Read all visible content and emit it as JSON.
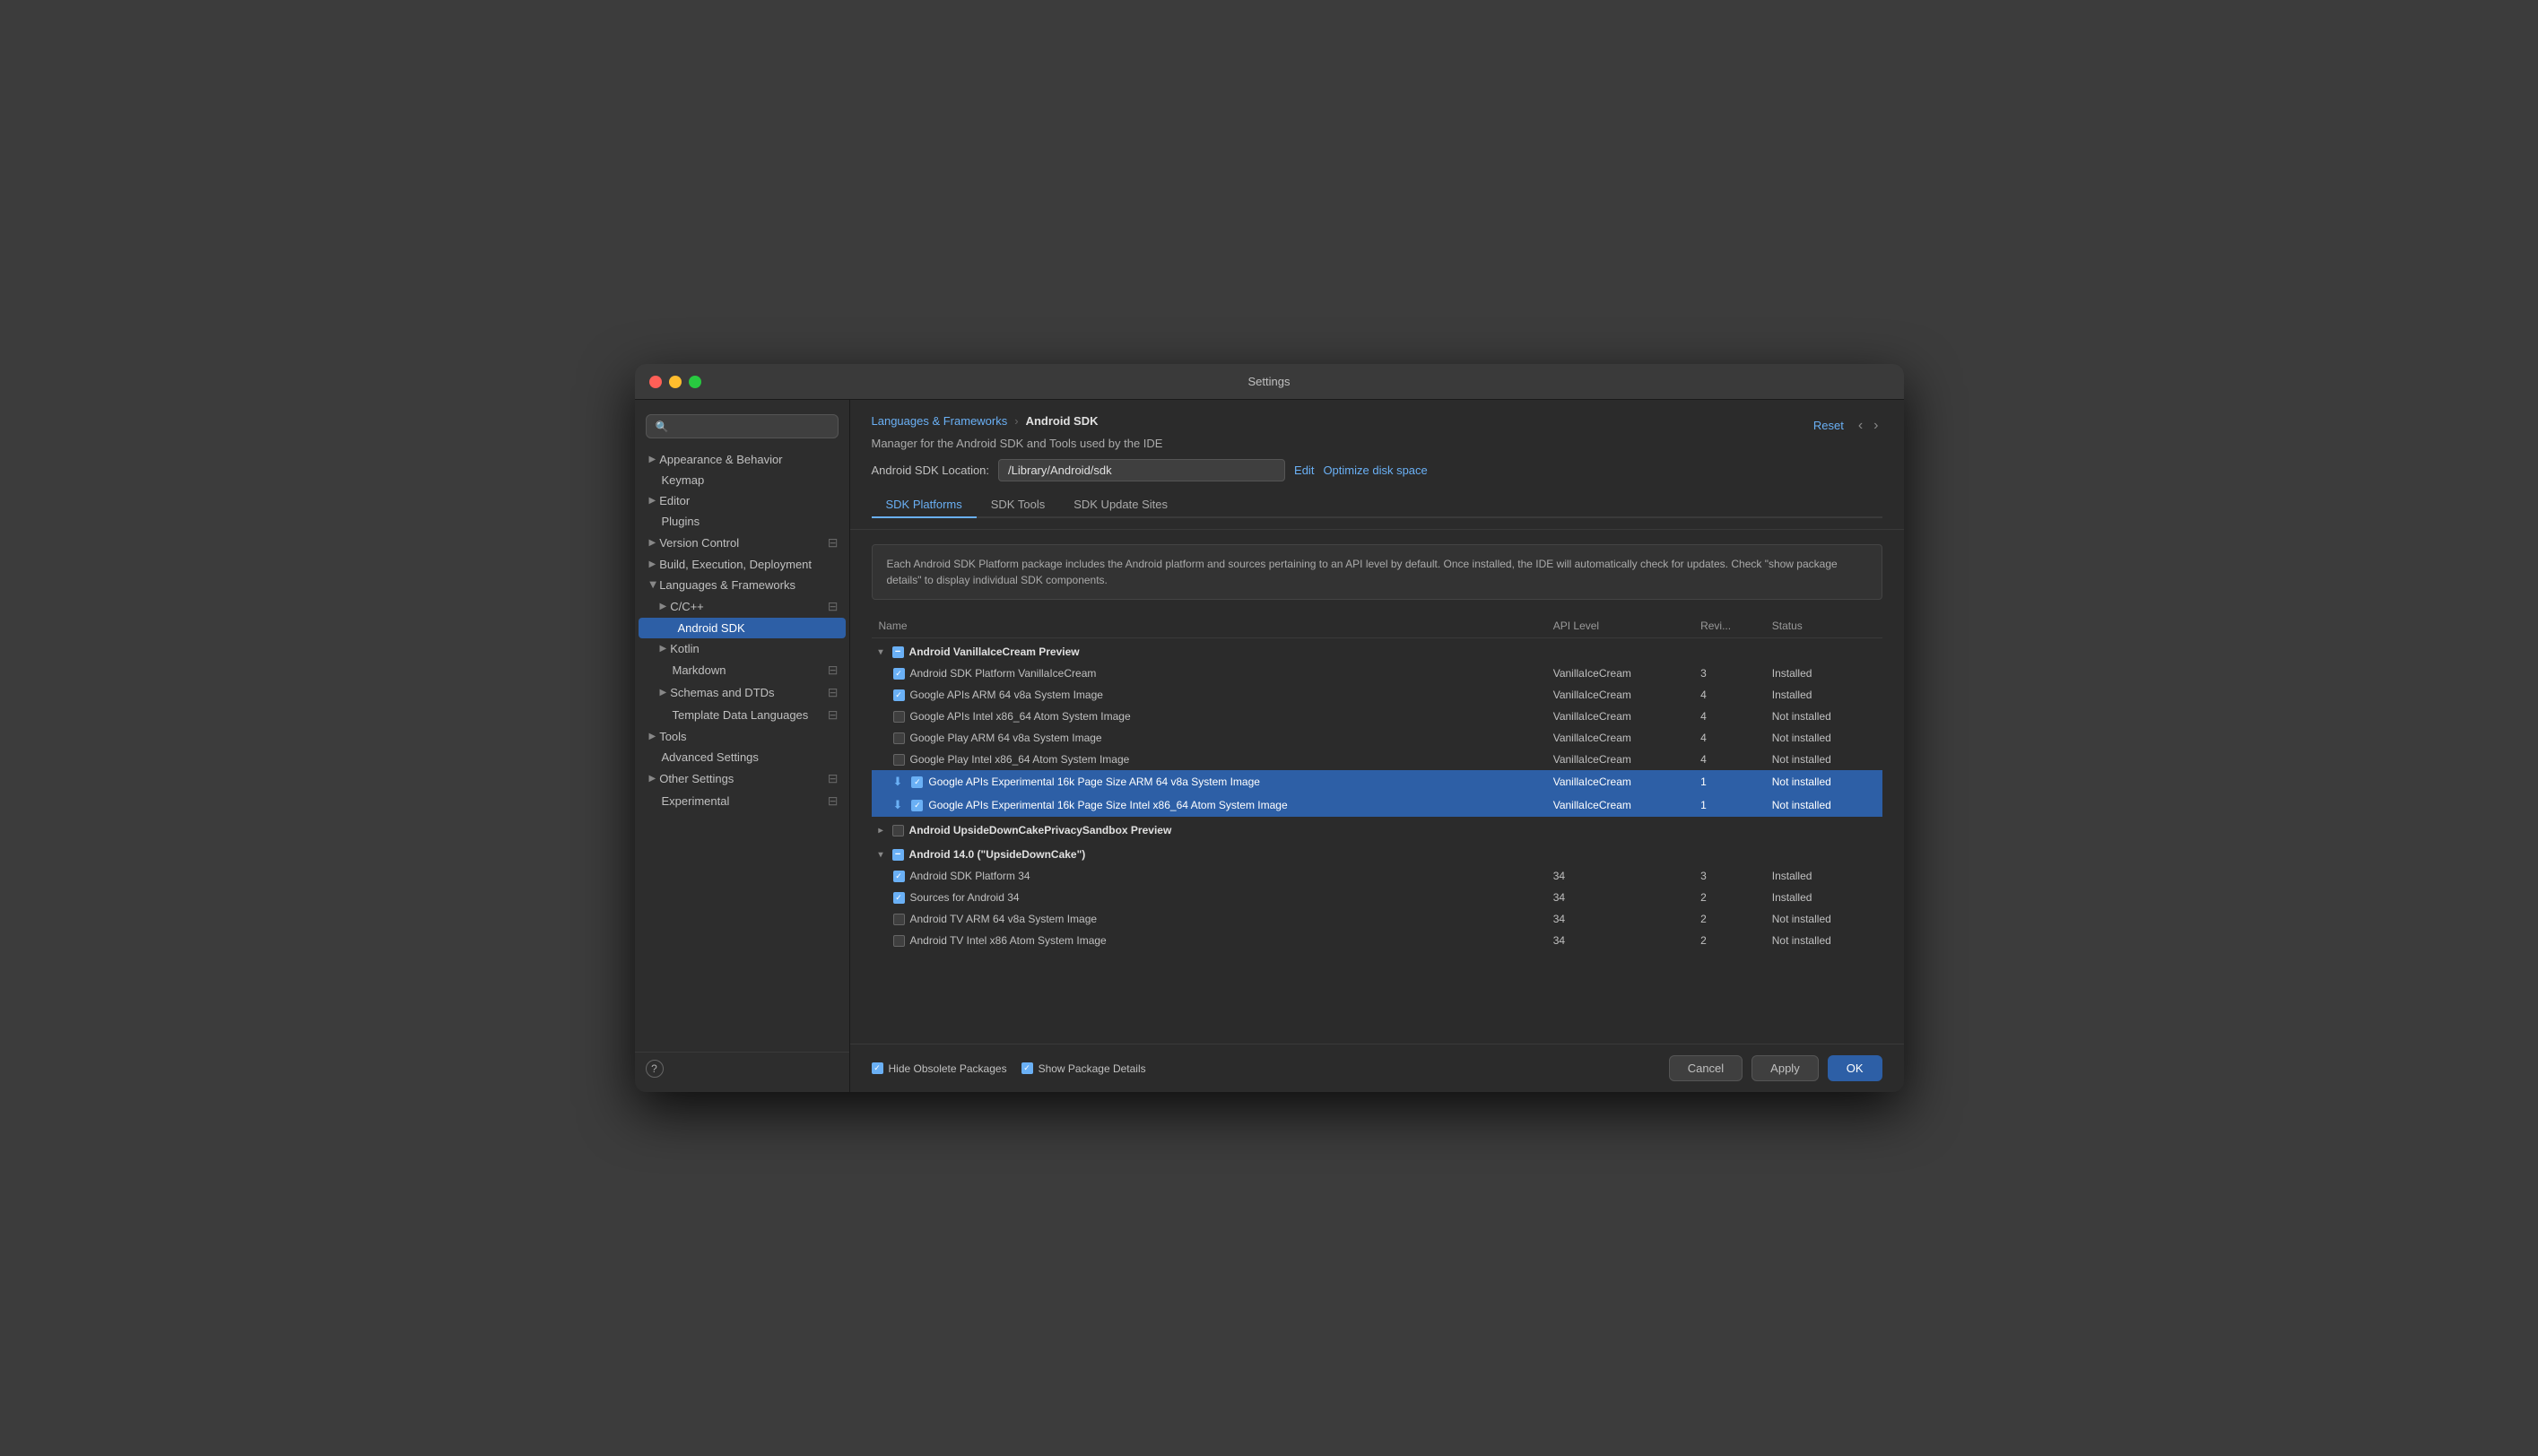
{
  "window": {
    "title": "Settings"
  },
  "sidebar": {
    "search_placeholder": "🔍",
    "items": [
      {
        "id": "appearance",
        "label": "Appearance & Behavior",
        "level": 0,
        "expandable": true,
        "expanded": false
      },
      {
        "id": "keymap",
        "label": "Keymap",
        "level": 0,
        "expandable": false
      },
      {
        "id": "editor",
        "label": "Editor",
        "level": 0,
        "expandable": true,
        "expanded": false
      },
      {
        "id": "plugins",
        "label": "Plugins",
        "level": 0,
        "expandable": false
      },
      {
        "id": "version-control",
        "label": "Version Control",
        "level": 0,
        "expandable": true,
        "expanded": false
      },
      {
        "id": "build",
        "label": "Build, Execution, Deployment",
        "level": 0,
        "expandable": true,
        "expanded": false
      },
      {
        "id": "languages",
        "label": "Languages & Frameworks",
        "level": 0,
        "expandable": true,
        "expanded": true
      },
      {
        "id": "cpp",
        "label": "C/C++",
        "level": 1,
        "expandable": true,
        "expanded": false
      },
      {
        "id": "android-sdk",
        "label": "Android SDK",
        "level": 2,
        "expandable": false,
        "selected": true
      },
      {
        "id": "kotlin",
        "label": "Kotlin",
        "level": 1,
        "expandable": true,
        "expanded": false
      },
      {
        "id": "markdown",
        "label": "Markdown",
        "level": 1,
        "expandable": false,
        "has_icon": true
      },
      {
        "id": "schemas",
        "label": "Schemas and DTDs",
        "level": 1,
        "expandable": true,
        "expanded": false
      },
      {
        "id": "template",
        "label": "Template Data Languages",
        "level": 1,
        "expandable": false,
        "has_icon": true
      },
      {
        "id": "tools",
        "label": "Tools",
        "level": 0,
        "expandable": true,
        "expanded": false
      },
      {
        "id": "advanced",
        "label": "Advanced Settings",
        "level": 0,
        "expandable": false
      },
      {
        "id": "other",
        "label": "Other Settings",
        "level": 0,
        "expandable": true,
        "expanded": false
      },
      {
        "id": "experimental",
        "label": "Experimental",
        "level": 0,
        "expandable": false,
        "has_icon": true
      }
    ]
  },
  "content": {
    "breadcrumb": {
      "parent": "Languages & Frameworks",
      "separator": "›",
      "current": "Android SDK"
    },
    "description": "Manager for the Android SDK and Tools used by the IDE",
    "sdk_location_label": "Android SDK Location:",
    "sdk_location_value": "/Library/Android/sdk",
    "edit_label": "Edit",
    "optimize_label": "Optimize disk space",
    "reset_label": "Reset",
    "tabs": [
      {
        "id": "platforms",
        "label": "SDK Platforms",
        "active": true
      },
      {
        "id": "tools",
        "label": "SDK Tools",
        "active": false
      },
      {
        "id": "update-sites",
        "label": "SDK Update Sites",
        "active": false
      }
    ],
    "info_text": "Each Android SDK Platform package includes the Android platform and sources pertaining to an API level by default. Once installed, the IDE will automatically check for updates. Check \"show package details\" to display individual SDK components.",
    "table": {
      "columns": [
        "Name",
        "API Level",
        "Revi...",
        "Status"
      ],
      "groups": [
        {
          "id": "vanilla",
          "name": "Android VanillaIceCream Preview",
          "expanded": true,
          "checkbox": "indeterminate",
          "rows": [
            {
              "name": "Android SDK Platform VanillaIceCream",
              "api": "VanillaIceCream",
              "rev": "3",
              "status": "Installed",
              "checked": true,
              "download": false,
              "highlighted": false
            },
            {
              "name": "Google APIs ARM 64 v8a System Image",
              "api": "VanillaIceCream",
              "rev": "4",
              "status": "Installed",
              "checked": true,
              "download": false,
              "highlighted": false
            },
            {
              "name": "Google APIs Intel x86_64 Atom System Image",
              "api": "VanillaIceCream",
              "rev": "4",
              "status": "Not installed",
              "checked": false,
              "download": false,
              "highlighted": false
            },
            {
              "name": "Google Play ARM 64 v8a System Image",
              "api": "VanillaIceCream",
              "rev": "4",
              "status": "Not installed",
              "checked": false,
              "download": false,
              "highlighted": false
            },
            {
              "name": "Google Play Intel x86_64 Atom System Image",
              "api": "VanillaIceCream",
              "rev": "4",
              "status": "Not installed",
              "checked": false,
              "download": false,
              "highlighted": false
            },
            {
              "name": "Google APIs Experimental 16k Page Size ARM 64 v8a System Image",
              "api": "VanillaIceCream",
              "rev": "1",
              "status": "Not installed",
              "checked": true,
              "download": true,
              "highlighted": true
            },
            {
              "name": "Google APIs Experimental 16k Page Size Intel x86_64 Atom System Image",
              "api": "VanillaIceCream",
              "rev": "1",
              "status": "Not installed",
              "checked": true,
              "download": true,
              "highlighted": true
            }
          ]
        },
        {
          "id": "upsidedown-sandbox",
          "name": "Android UpsideDownCakePrivacySandbox Preview",
          "expanded": false,
          "checkbox": "unchecked",
          "rows": []
        },
        {
          "id": "upsidedown",
          "name": "Android 14.0 (\"UpsideDownCake\")",
          "expanded": true,
          "checkbox": "indeterminate",
          "rows": [
            {
              "name": "Android SDK Platform 34",
              "api": "34",
              "rev": "3",
              "status": "Installed",
              "checked": true,
              "download": false,
              "highlighted": false
            },
            {
              "name": "Sources for Android 34",
              "api": "34",
              "rev": "2",
              "status": "Installed",
              "checked": true,
              "download": false,
              "highlighted": false
            },
            {
              "name": "Android TV ARM 64 v8a System Image",
              "api": "34",
              "rev": "2",
              "status": "Not installed",
              "checked": false,
              "download": false,
              "highlighted": false
            },
            {
              "name": "Android TV Intel x86 Atom System Image",
              "api": "34",
              "rev": "2",
              "status": "Not installed",
              "checked": false,
              "download": false,
              "highlighted": false
            }
          ]
        }
      ]
    },
    "footer": {
      "hide_obsolete": {
        "label": "Hide Obsolete Packages",
        "checked": true
      },
      "show_details": {
        "label": "Show Package Details",
        "checked": true
      },
      "cancel_label": "Cancel",
      "apply_label": "Apply",
      "ok_label": "OK"
    }
  }
}
